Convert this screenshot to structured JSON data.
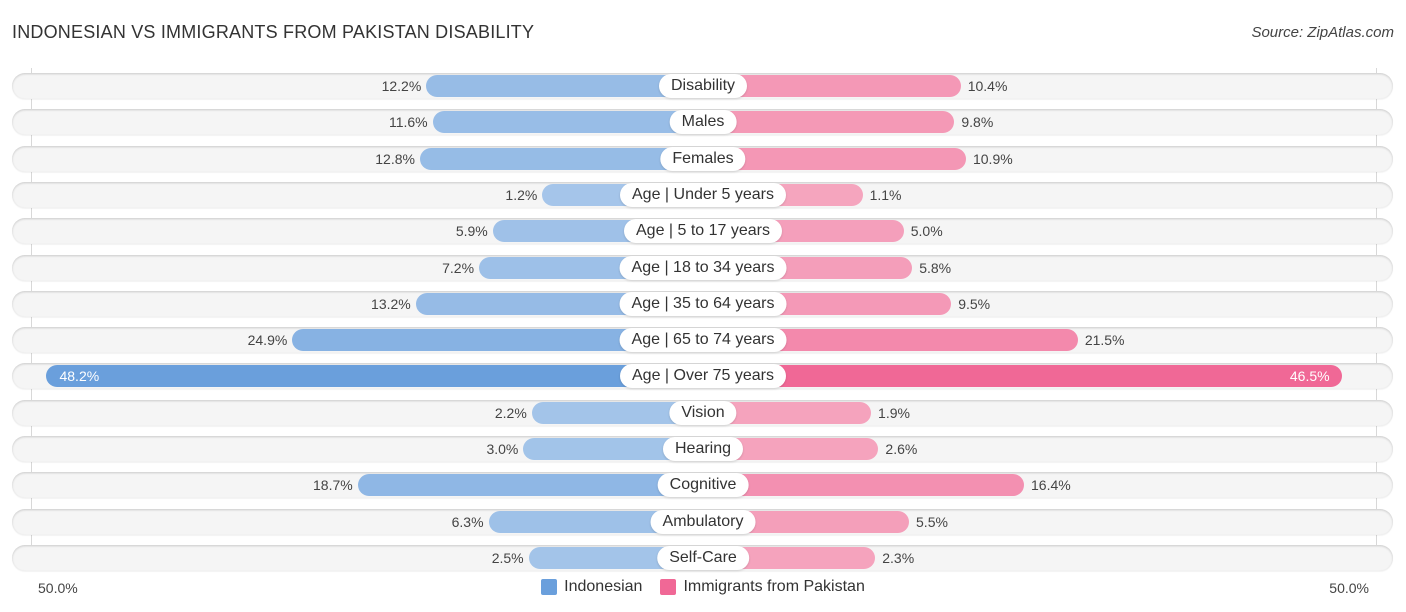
{
  "header": {
    "title": "INDONESIAN VS IMMIGRANTS FROM PAKISTAN DISABILITY",
    "source": "Source: ZipAtlas.com"
  },
  "colors": {
    "indonesian": "#6a9fdc",
    "indonesian_light": "#a6c6ea",
    "pakistan": "#f06896",
    "pakistan_light": "#f5a6bf"
  },
  "chart_data": {
    "type": "bar",
    "orientation": "horizontal-diverging",
    "title": "INDONESIAN VS IMMIGRANTS FROM PAKISTAN DISABILITY",
    "categories": [
      "Disability",
      "Males",
      "Females",
      "Age | Under 5 years",
      "Age | 5 to 17 years",
      "Age | 18 to 34 years",
      "Age | 35 to 64 years",
      "Age | 65 to 74 years",
      "Age | Over 75 years",
      "Vision",
      "Hearing",
      "Cognitive",
      "Ambulatory",
      "Self-Care"
    ],
    "series": [
      {
        "name": "Indonesian",
        "side": "left",
        "values": [
          12.2,
          11.6,
          12.8,
          1.2,
          5.9,
          7.2,
          13.2,
          24.9,
          48.2,
          2.2,
          3.0,
          18.7,
          6.3,
          2.5
        ]
      },
      {
        "name": "Immigrants from Pakistan",
        "side": "right",
        "values": [
          10.4,
          9.8,
          10.9,
          1.1,
          5.0,
          5.8,
          9.5,
          21.5,
          46.5,
          1.9,
          2.6,
          16.4,
          5.5,
          2.3
        ]
      }
    ],
    "value_labels": {
      "left": [
        "12.2%",
        "11.6%",
        "12.8%",
        "1.2%",
        "5.9%",
        "7.2%",
        "13.2%",
        "24.9%",
        "48.2%",
        "2.2%",
        "3.0%",
        "18.7%",
        "6.3%",
        "2.5%"
      ],
      "right": [
        "10.4%",
        "9.8%",
        "10.9%",
        "1.1%",
        "5.0%",
        "5.8%",
        "9.5%",
        "21.5%",
        "46.5%",
        "1.9%",
        "2.6%",
        "16.4%",
        "5.5%",
        "2.3%"
      ]
    },
    "xlim": [
      -50,
      50
    ],
    "axis_labels": {
      "left": "50.0%",
      "right": "50.0%"
    },
    "unit": "%",
    "legend": {
      "position": "bottom-center",
      "entries": [
        "Indonesian",
        "Immigrants from Pakistan"
      ]
    },
    "grid": false
  }
}
